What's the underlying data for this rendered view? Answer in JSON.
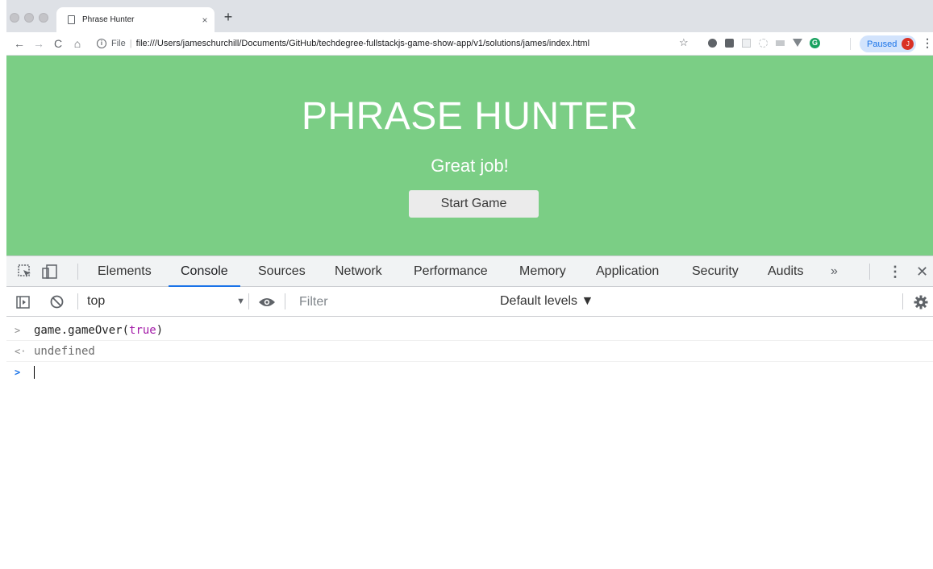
{
  "browser": {
    "tab_title": "Phrase Hunter",
    "tab_close_glyph": "×",
    "new_tab_glyph": "+",
    "back_glyph": "←",
    "forward_glyph": "→",
    "reload_glyph": "C",
    "home_glyph": "⌂",
    "scheme_label": "File",
    "url": "file:///Users/jameschurchill/Documents/GitHub/techdegree-fullstackjs-game-show-app/v1/solutions/james/index.html",
    "star_glyph": "☆",
    "profile_status": "Paused",
    "profile_initial": "J",
    "menu_glyph": "⋮"
  },
  "page": {
    "title": "PHRASE HUNTER",
    "message": "Great job!",
    "start_button": "Start Game",
    "background": "#7bce85"
  },
  "devtools": {
    "tabs": [
      "Elements",
      "Console",
      "Sources",
      "Network",
      "Performance",
      "Memory",
      "Application",
      "Security",
      "Audits"
    ],
    "active_tab": "Console",
    "more_glyph": "»",
    "menu_glyph": "⋮",
    "close_glyph": "✕",
    "context": "top",
    "context_arrow": "▼",
    "filter_placeholder": "Filter",
    "levels": "Default levels ▼",
    "console": {
      "input_prompt": ">",
      "input_code": "game.gameOver(",
      "input_arg": "true",
      "input_close": ")",
      "result_prompt": "<·",
      "result_text": "undefined",
      "active_prompt": ">"
    }
  },
  "colors": {
    "accent": "#1a73e8",
    "keyword": "#a31aa8"
  }
}
